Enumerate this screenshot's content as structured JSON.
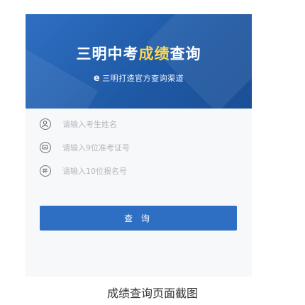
{
  "banner": {
    "title_part1": "三明中考",
    "title_part2": "成绩",
    "title_part3": "查询",
    "subtitle": "三明打造官方查询渠道",
    "subtitle_icon": "e-logo-icon",
    "colors": {
      "background": "#2f6fc3",
      "highlight": "#ffd84a"
    }
  },
  "form": {
    "name_placeholder": "请输入考生姓名",
    "ticket_placeholder": "请输入9位准考证号",
    "reg_placeholder": "请输入10位报名号",
    "icons": [
      "user-icon",
      "id-card-icon",
      "number-icon"
    ]
  },
  "query_button": "查 询",
  "caption": "成绩查询页面截图"
}
